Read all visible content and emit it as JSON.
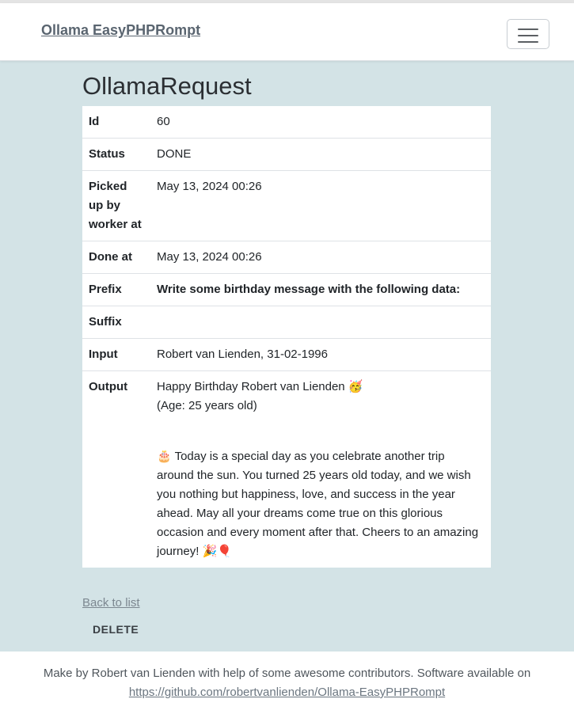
{
  "nav": {
    "brand": "Ollama EasyPHPRompt",
    "toggler_icon": "hamburger-menu-icon"
  },
  "page": {
    "title": "OllamaRequest"
  },
  "details": [
    {
      "label": "Id",
      "value": "60"
    },
    {
      "label": "Status",
      "value": "DONE"
    },
    {
      "label": "Picked up by worker at",
      "value": "May 13, 2024 00:26"
    },
    {
      "label": "Done at",
      "value": "May 13, 2024 00:26"
    },
    {
      "label": "Prefix",
      "value": "Write some birthday message with the following data:"
    },
    {
      "label": "Suffix",
      "value": ""
    },
    {
      "label": "Input",
      "value": "Robert van Lienden, 31-02-1996"
    }
  ],
  "output": {
    "label": "Output",
    "line1": "Happy Birthday Robert van Lienden 🥳",
    "line2": "(Age: 25 years old)",
    "paragraph": "🎂 Today is a special day as you celebrate another trip around the sun. You turned 25 years old today, and we wish you nothing but happiness, love, and success in the year ahead. May all your dreams come true on this glorious occasion and every moment after that. Cheers to an amazing journey! 🎉🎈"
  },
  "actions": {
    "back_label": "Back to list",
    "delete_label": "DELETE"
  },
  "footer": {
    "text": "Make by Robert van Lienden with help of some awesome contributors. Software available on",
    "link": "https://github.com/robertvanlienden/Ollama-EasyPHPRompt"
  }
}
